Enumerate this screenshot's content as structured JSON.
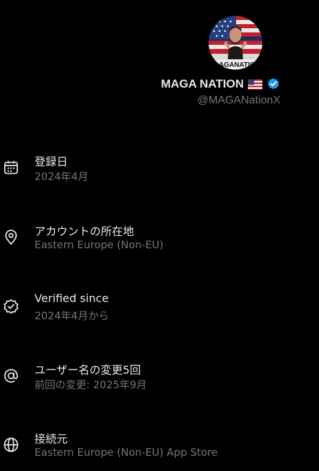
{
  "profile": {
    "display_name": "MAGA NATION",
    "flag_emoji": "🇺🇸",
    "handle": "@MAGANationX",
    "avatar_caption": "AGANATIC",
    "verified_badge_color": "#1d9bf0"
  },
  "details": [
    {
      "icon": "calendar-icon",
      "title": "登録日",
      "value": "2024年4月"
    },
    {
      "icon": "location-pin-icon",
      "title": "アカウントの所在地",
      "value": "Eastern Europe (Non-EU)"
    },
    {
      "icon": "verified-badge-icon",
      "title": "Verified since",
      "value": "2024年4月から"
    },
    {
      "icon": "at-sign-icon",
      "title": "ユーザー名の変更5回",
      "value": "前回の変更: 2025年9月"
    },
    {
      "icon": "globe-icon",
      "title": "接続元",
      "value": "Eastern Europe (Non-EU) App Store"
    }
  ],
  "colors": {
    "background": "#000000",
    "primary_text": "#e7e9ea",
    "secondary_text": "#71767b",
    "accent": "#1d9bf0"
  }
}
